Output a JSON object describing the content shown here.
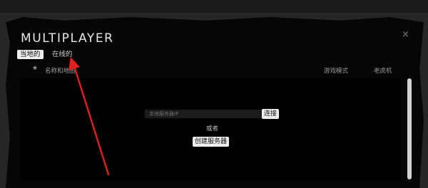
{
  "window": {
    "title": "MULTIPLAYER",
    "close_glyph": "×"
  },
  "tabs": [
    {
      "label": "当地的",
      "active": true
    },
    {
      "label": "在线的",
      "active": false
    }
  ],
  "server_list": {
    "favorite_icon": "star-icon",
    "columns": {
      "name": "名称和地图",
      "mode": "游戏模式",
      "slots": "老虎机"
    }
  },
  "connect": {
    "ip_placeholder": "本地服务器IP",
    "connect_label": "连接",
    "or_label": "或者",
    "create_label": "创建服务器"
  },
  "annotation": {
    "arrow_color": "#e02020"
  }
}
